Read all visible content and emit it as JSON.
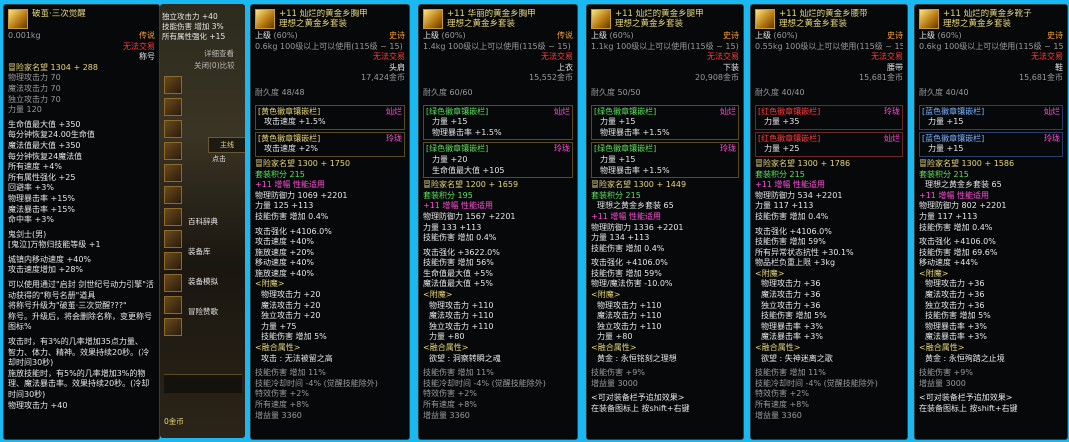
{
  "p1": {
    "title": "破茧·三次觉醒",
    "weight": "0.001kg",
    "rarity": "传说",
    "trade": "无法交易",
    "slot": "称号",
    "fame": "冒险家名望 1304 + 288",
    "stats": [
      "物理攻击力 70",
      "魔法攻击力 70",
      "独立攻击力 70",
      "力量 120"
    ],
    "stats2": [
      "生命值最大值 +350",
      "每分钟恢复24.00生命值",
      "魔法值最大值 +350",
      "每分钟恢复24魔法值",
      "所有速度 +4%",
      "所有属性强化 +25",
      "回避率 +3%",
      "物理暴击率 +15%",
      "魔法暴击率 +15%",
      "命中率 +3%"
    ],
    "skill_title": "鬼剑士(男)",
    "skill_line": "[鬼泣]万物归技能等级 +1",
    "extra": [
      "城镇内移动速度 +40%",
      "攻击速度增加 +28%"
    ],
    "desc": [
      "可以使用通过\"启封 剑世纪号动力引擎\"活动获得的\"称号名册\"道具",
      "将称号升级为\"破茧·三次觉醒???\"",
      "称号。升级后，将会删除名称，变更称号图标%"
    ],
    "desc2": [
      "攻击时，有3%的几率增加35点力量、",
      "智力、体力、精神。效果持续20秒。(冷却时间30秒)",
      "施放技能时，有5%的几率增加3%的物理、魔法暴击率。效果持续20秒。(冷却时间30秒)"
    ],
    "last": "物理攻击力 +40"
  },
  "game": {
    "overlay": [
      "独立攻击力 +40",
      "技能伤害 增加 3%",
      "所有属性强化 +15"
    ],
    "hint1": "详细查看",
    "hint2": "关闭(0)比较",
    "btn_mark": "主线",
    "btn_mark2": "点击",
    "menu": [
      "百科辞典",
      "装备库",
      "装备模拟",
      "冒险赞歌"
    ],
    "gold": "0金币"
  },
  "p2": {
    "title": "+11 灿烂的黄金乡胸甲",
    "subtitle": "理想之黄金乡套装",
    "grade": "上级",
    "pct": "(60%)",
    "rarity": "史诗",
    "weight": "0.6kg",
    "level": "100级以上可以使用(115级 ~ 15)",
    "trade": "无法交易",
    "slot": "头肩",
    "price": "17,424金币",
    "durability": "耐久度 48/48",
    "orb1": "[黄色徽章镶嵌栏]",
    "orb1_right": "灿烂",
    "orb1_stat": "攻击速度 +1.5%",
    "orb2": "[黄色徽章镶嵌栏]",
    "orb2_right": "玲珑",
    "orb2_stat": "攻击速度 +2%",
    "fame": "冒险家名望 1300 + 1750",
    "set_pts": "套装积分 215",
    "enh": "+11 增幅 性能适用",
    "enh_stat": "物理防御力 1069 +2201",
    "str": "力量 125 +113",
    "skill": "技能伤害 增加 0.4%",
    "bonus": [
      "攻击强化 +4106.0%",
      "攻击速度 +40%",
      "施放速度 +20%",
      "移动速度 +40%",
      "施放速度 +40%"
    ],
    "attach": "<附魔>",
    "attach_stats": [
      "物理攻击力 +20",
      "魔法攻击力 +20",
      "独立攻击力 +20",
      "力量 +75",
      "技能伤害 增加 5%"
    ],
    "fuse": "<融合属性>",
    "fuse_name": "攻击 : 无法被留之高",
    "fuse_stats": [
      "技能伤害 增加 11%",
      "技能冷却时间 -4% (觉醒技能除外)",
      "特效伤害 +2%",
      "所有速度 +8%",
      "增益量 3360"
    ]
  },
  "p3": {
    "title": "+11 华丽的黄金乡胸甲",
    "subtitle": "理想之黄金乡套装",
    "grade": "上级",
    "pct": "(60%)",
    "rarity": "传说",
    "weight": "1.4kg",
    "level": "100级以上可以使用(115级 ~ 15)",
    "trade": "无法交易",
    "slot": "上衣",
    "price": "15,552金币",
    "durability": "耐久度 60/60",
    "orb1": "[绿色徽章镶嵌栏]",
    "orb1_right": "灿烂",
    "orb1_stat": [
      "力量 +15",
      "物理暴击率 +1.5%"
    ],
    "orb2": "[绿色徽章镶嵌栏]",
    "orb2_right": "玲珑",
    "orb2_stat": [
      "力量 +20",
      "生命值最大值 +105"
    ],
    "fame": "冒险家名望 1200 + 1659",
    "set_pts": "套装积分 195",
    "enh": "+11 增幅 性能适用",
    "enh_stat": "物理防御力 1567 +2201",
    "str": "力量 133 +113",
    "skill": "技能伤害 增加 0.4%",
    "bonus": [
      "攻击强化 +3622.0%",
      "技能伤害 增加 56%",
      "生命值最大值 +5%",
      "魔法值最大值 +5%"
    ],
    "attach": "<附魔>",
    "attach_stats": [
      "物理攻击力 +110",
      "魔法攻击力 +110",
      "独立攻击力 +110",
      "力量 +80"
    ],
    "fuse": "<融合属性>",
    "fuse_name": "欲望 : 洞察转瞬之魂",
    "fuse_stats": [
      "技能伤害 增加 11%",
      "技能冷却时间 -4% (觉醒技能除外)",
      "特效伤害 +2%",
      "所有速度 +8%",
      "增益量 3360"
    ]
  },
  "p4": {
    "title": "+11 灿烂的黄金乡腿甲",
    "subtitle": "理想之黄金乡套装",
    "grade": "上级",
    "pct": "(60%)",
    "rarity": "史诗",
    "weight": "1.1kg",
    "level": "100级以上可以使用(115级 ~ 15)",
    "trade": "无法交易",
    "slot": "下装",
    "price": "20,908金币",
    "durability": "耐久度 50/50",
    "orb1": "[绿色徽章镶嵌栏]",
    "orb1_right": "灿烂",
    "orb1_stat": [
      "力量 +15",
      "物理暴击率 +1.5%"
    ],
    "orb2": "[绿色徽章镶嵌栏]",
    "orb2_right": "玲珑",
    "orb2_stat": [
      "力量 +15",
      "物理暴击率 +1.5%"
    ],
    "fame": "冒险家名望 1300 + 1449",
    "set_pts": "套装积分 215",
    "set_name": "理想之黄金乡套装 65",
    "enh": "+11 增幅 性能适用",
    "enh_stat": "物理防御力 1336 +2201",
    "str": "力量 134 +113",
    "skill": "技能伤害 增加 0.4%",
    "bonus": [
      "攻击强化 +4106.0%",
      "技能伤害 增加 59%",
      "物理/魔法伤害 -10.0%"
    ],
    "attach": "<附魔>",
    "attach_stats": [
      "物理攻击力 +110",
      "魔法攻击力 +110",
      "独立攻击力 +110",
      "力量 +80"
    ],
    "fuse": "<融合属性>",
    "fuse_name": "黄金 : 永恒铭刻之理想",
    "fuse_stats": [
      "技能伤害 +9%",
      "增益量 3000"
    ],
    "note1": "<可对装备栏予追加效果>",
    "note2": "在装备图标上 按shift+右键"
  },
  "p5": {
    "title": "+11 灿烂的黄金乡腰带",
    "subtitle": "理想之黄金乡套装",
    "grade": "上级",
    "pct": "(60%)",
    "rarity": "史诗",
    "weight": "0.55kg",
    "level": "100级以上可以使用(115级 ~ 15)",
    "trade": "无法交易",
    "slot": "腰带",
    "price": "15,681金币",
    "durability": "耐久度 40/40",
    "orb1": "[红色徽章镶嵌栏]",
    "orb1_right": "玲珑",
    "orb1_stat": "力量 +35",
    "orb2": "[红色徽章镶嵌栏]",
    "orb2_right": "灿烂",
    "orb2_stat": "力量 +25",
    "fame": "冒险家名望 1300 + 1786",
    "set_pts": "套装积分 215",
    "enh": "+11 增幅 性能适用",
    "enh_stat": "物理防御力 534 +2201",
    "str": "力量 117 +113",
    "skill": "技能伤害 增加 0.4%",
    "bonus": [
      "攻击强化 +4106.0%",
      "技能伤害 增加 59%",
      "所有异常状态抗性 +30.1%",
      "物品栏负重上限 +3kg"
    ],
    "attach": "<附魔>",
    "attach_stats": [
      "物理攻击力 +36",
      "魔法攻击力 +36",
      "独立攻击力 +36",
      "技能伤害 增加 5%",
      "物理暴击率 +3%",
      "魔法暴击率 +3%"
    ],
    "fuse": "<融合属性>",
    "fuse_name": "欲望 : 失神迷离之歌",
    "fuse_stats": [
      "技能伤害 增加 11%",
      "技能冷却时间 -4% (觉醒技能除外)",
      "特效伤害 +2%",
      "所有速度 +8%",
      "增益量 3360"
    ]
  },
  "p6": {
    "title": "+11 灿烂的黄金乡靴子",
    "subtitle": "理想之黄金乡套装",
    "grade": "上级",
    "pct": "(60%)",
    "rarity": "史诗",
    "weight": "0.6kg",
    "level": "100级以上可以使用(115级 ~ 15)",
    "trade": "无法交易",
    "slot": "鞋",
    "price": "15,681金币",
    "durability": "耐久度 40/40",
    "orb1": "[蓝色徽章镶嵌栏]",
    "orb1_right": "灿烂",
    "orb1_stat": "力量 +15",
    "orb2": "[蓝色徽章镶嵌栏]",
    "orb2_right": "玲珑",
    "orb2_stat": "力量 +15",
    "fame": "冒险家名望 1300 + 1586",
    "set_pts": "套装积分 215",
    "set_name": "理想之黄金乡套装 65",
    "enh": "+11 增幅 性能适用",
    "enh_stat": "物理防御力 802 +2201",
    "str": "力量 117 +113",
    "skill": "技能伤害 增加 0.4%",
    "bonus": [
      "攻击强化 +4106.0%",
      "技能伤害 增加 69.6%",
      "移动速度 +44%"
    ],
    "attach": "<附魔>",
    "attach_stats": [
      "物理攻击力 +36",
      "魔法攻击力 +36",
      "独立攻击力 +36",
      "技能伤害 增加 5%",
      "物理暴击率 +3%",
      "魔法暴击率 +3%"
    ],
    "fuse": "<融合属性>",
    "fuse_name": "黄金 : 永恒殉踏之止境",
    "fuse_stats": [
      "技能伤害 +9%",
      "增益量 3000"
    ],
    "note1": "<可对装备栏予追加效果>",
    "note2": "在装备图标上 按shift+右键"
  }
}
